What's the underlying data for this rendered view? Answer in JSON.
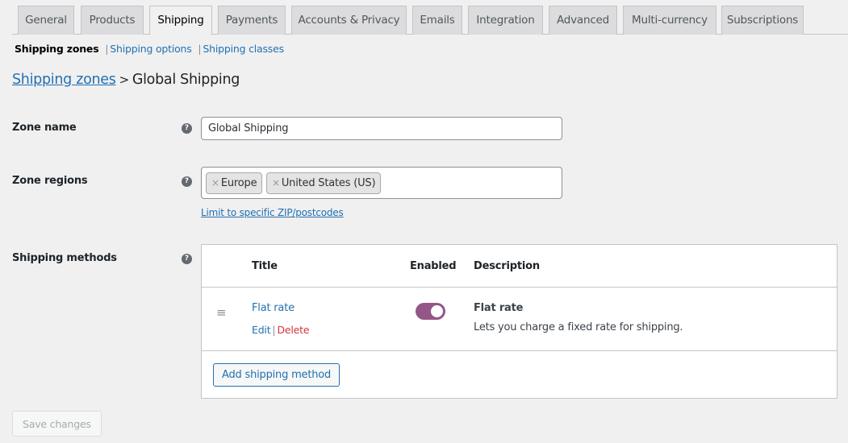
{
  "tabs": [
    {
      "label": "General",
      "active": false
    },
    {
      "label": "Products",
      "active": false
    },
    {
      "label": "Shipping",
      "active": true
    },
    {
      "label": "Payments",
      "active": false
    },
    {
      "label": "Accounts & Privacy",
      "active": false
    },
    {
      "label": "Emails",
      "active": false
    },
    {
      "label": "Integration",
      "active": false
    },
    {
      "label": "Advanced",
      "active": false
    },
    {
      "label": "Multi-currency",
      "active": false
    },
    {
      "label": "Subscriptions",
      "active": false
    }
  ],
  "subnav": {
    "current": "Shipping zones",
    "separator": "|",
    "links": [
      "Shipping options",
      "Shipping classes"
    ]
  },
  "heading": {
    "parent_link": "Shipping zones",
    "separator": ">",
    "current": "Global Shipping"
  },
  "form": {
    "zone_name_label": "Zone name",
    "zone_name_value": "Global Shipping",
    "zone_regions_label": "Zone regions",
    "regions": [
      "Europe",
      "United States (US)"
    ],
    "remove_glyph": "×",
    "limit_link": "Limit to specific ZIP/postcodes",
    "shipping_methods_label": "Shipping methods",
    "help_glyph": "?"
  },
  "methods_table": {
    "columns": [
      "Title",
      "Enabled",
      "Description"
    ],
    "rows": [
      {
        "title": "Flat rate",
        "edit_label": "Edit",
        "action_separator": "|",
        "delete_label": "Delete",
        "enabled": true,
        "description_title": "Flat rate",
        "description_text": "Lets you charge a fixed rate for shipping."
      }
    ],
    "add_button": "Add shipping method"
  },
  "save_button": "Save changes",
  "colors": {
    "link": "#2271b1",
    "delete": "#d63638",
    "toggle_on": "#935687",
    "background": "#f0f0f1"
  }
}
